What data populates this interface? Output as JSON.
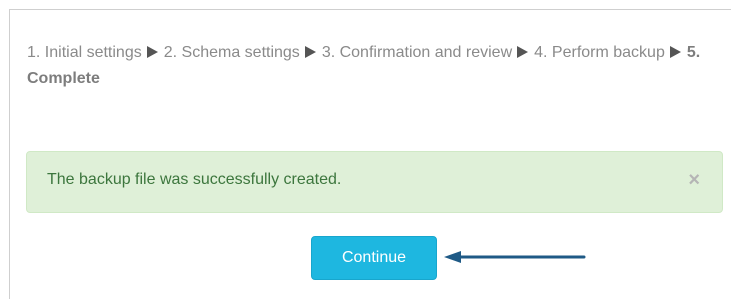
{
  "breadcrumb": {
    "steps": [
      "1. Initial settings",
      "2. Schema settings",
      "3. Confirmation and review",
      "4. Perform backup"
    ],
    "current": "5. Complete"
  },
  "alert": {
    "message": "The backup file was successfully created.",
    "close_glyph": "×"
  },
  "continue_button": {
    "label": "Continue"
  },
  "colors": {
    "alert_background": "#dff0d8",
    "alert_text": "#3c763d",
    "button": "#1eb7e0",
    "annotation_arrow": "#1f5a86"
  }
}
